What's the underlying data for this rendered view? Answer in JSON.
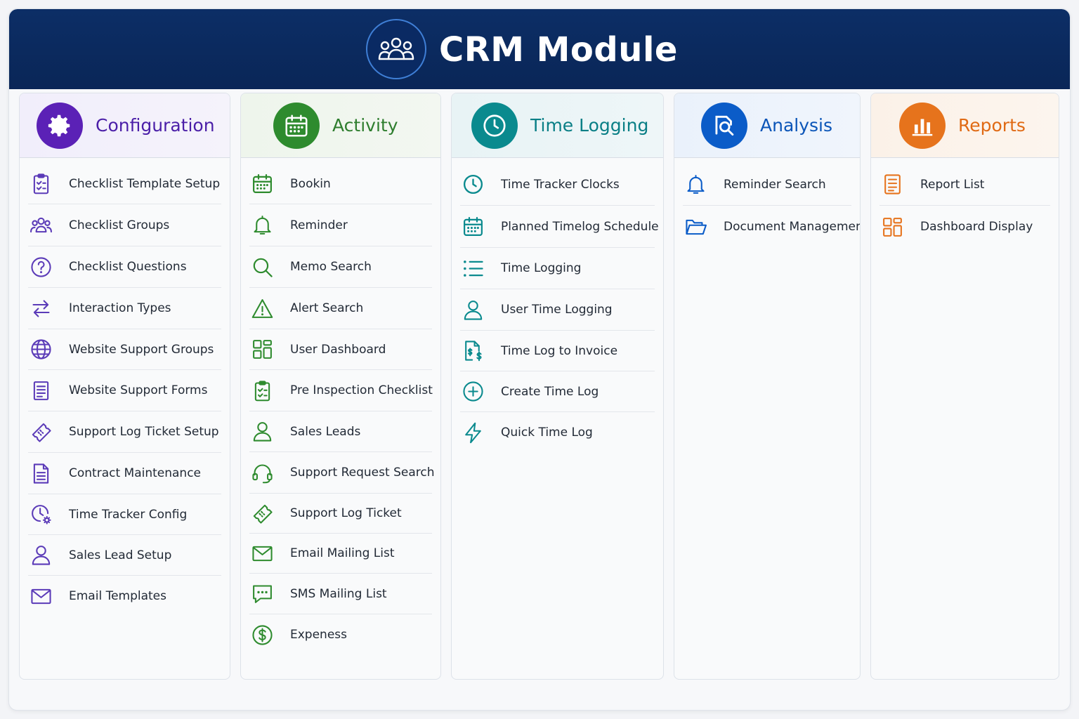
{
  "header": {
    "title": "CRM Module",
    "icon": "users-group-icon"
  },
  "colors": {
    "header_bg": "#0c2e66",
    "configuration": "#5b21b6",
    "activity": "#2e8b2e",
    "time_logging": "#0a8a8e",
    "analysis": "#0b5cc8",
    "reports": "#e6731c"
  },
  "columns": [
    {
      "key": "configuration",
      "title": "Configuration",
      "icon": "gear-icon",
      "items": [
        {
          "label": "Checklist Template Setup",
          "icon": "clipboard-check-icon"
        },
        {
          "label": "Checklist Groups",
          "icon": "users-group-icon"
        },
        {
          "label": "Checklist Questions",
          "icon": "question-circle-icon"
        },
        {
          "label": "Interaction Types",
          "icon": "arrows-exchange-icon"
        },
        {
          "label": "Website Support Groups",
          "icon": "globe-icon"
        },
        {
          "label": "Website Support Forms",
          "icon": "form-document-icon"
        },
        {
          "label": "Support Log Ticket Setup",
          "icon": "ticket-icon"
        },
        {
          "label": "Contract Maintenance",
          "icon": "document-icon"
        },
        {
          "label": "Time Tracker Config",
          "icon": "clock-gear-icon"
        },
        {
          "label": "Sales Lead Setup",
          "icon": "user-icon"
        },
        {
          "label": "Email Templates",
          "icon": "envelope-icon"
        }
      ]
    },
    {
      "key": "activity",
      "title": "Activity",
      "icon": "calendar-icon",
      "items": [
        {
          "label": "Bookin",
          "icon": "calendar-icon"
        },
        {
          "label": "Reminder",
          "icon": "bell-icon"
        },
        {
          "label": "Memo Search",
          "icon": "search-icon"
        },
        {
          "label": "Alert Search",
          "icon": "warning-icon"
        },
        {
          "label": "User Dashboard",
          "icon": "dashboard-grid-icon"
        },
        {
          "label": "Pre Inspection Checklist",
          "icon": "clipboard-check-icon"
        },
        {
          "label": "Sales Leads",
          "icon": "user-icon"
        },
        {
          "label": "Support Request Search",
          "icon": "headset-icon"
        },
        {
          "label": "Support Log Ticket",
          "icon": "ticket-icon"
        },
        {
          "label": "Email Mailing List",
          "icon": "envelope-icon"
        },
        {
          "label": "SMS Mailing List",
          "icon": "chat-bubble-icon"
        },
        {
          "label": "Expeness",
          "icon": "dollar-circle-icon"
        }
      ]
    },
    {
      "key": "time_logging",
      "title": "Time Logging",
      "icon": "clock-icon",
      "items": [
        {
          "label": "Time Tracker Clocks",
          "icon": "clock-icon"
        },
        {
          "label": "Planned Timelog Schedule",
          "icon": "calendar-icon"
        },
        {
          "label": "Time Logging",
          "icon": "list-icon"
        },
        {
          "label": "User Time Logging",
          "icon": "user-icon"
        },
        {
          "label": "Time Log to Invoice",
          "icon": "invoice-dollar-icon"
        },
        {
          "label": "Create Time Log",
          "icon": "plus-circle-icon"
        },
        {
          "label": "Quick Time Log",
          "icon": "lightning-icon"
        }
      ]
    },
    {
      "key": "analysis",
      "title": "Analysis",
      "icon": "magnifier-document-icon",
      "items": [
        {
          "label": "Reminder Search",
          "icon": "bell-icon"
        },
        {
          "label": "Document Management",
          "icon": "folder-icon"
        }
      ]
    },
    {
      "key": "reports",
      "title": "Reports",
      "icon": "bar-chart-icon",
      "items": [
        {
          "label": "Report List",
          "icon": "document-list-icon"
        },
        {
          "label": "Dashboard Display",
          "icon": "dashboard-grid-icon"
        }
      ]
    }
  ]
}
